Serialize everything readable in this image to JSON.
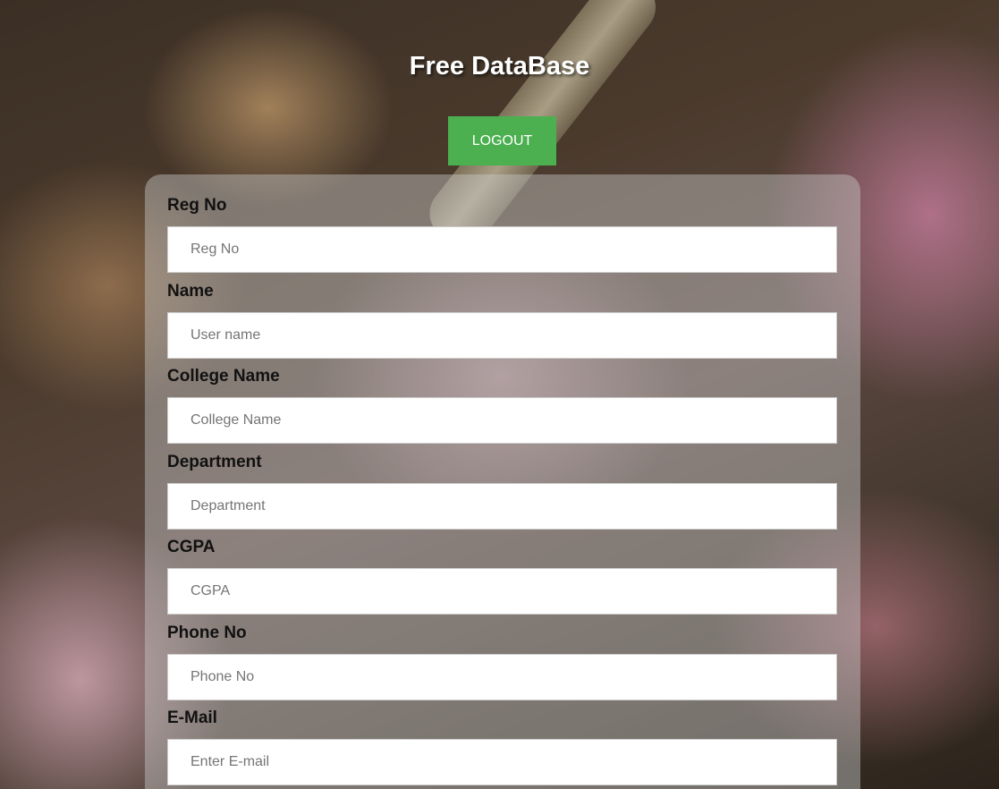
{
  "header": {
    "title": "Free DataBase",
    "logout_label": "LOGOUT"
  },
  "form": {
    "fields": [
      {
        "label": "Reg No",
        "placeholder": "Reg No",
        "value": ""
      },
      {
        "label": "Name",
        "placeholder": "User name",
        "value": ""
      },
      {
        "label": "College Name",
        "placeholder": "College Name",
        "value": ""
      },
      {
        "label": "Department",
        "placeholder": "Department",
        "value": ""
      },
      {
        "label": "CGPA",
        "placeholder": "CGPA",
        "value": ""
      },
      {
        "label": "Phone No",
        "placeholder": "Phone No",
        "value": ""
      },
      {
        "label": "E-Mail",
        "placeholder": "Enter E-mail",
        "value": ""
      }
    ]
  },
  "colors": {
    "logout_button": "#4caf50",
    "title_text": "#ffffff",
    "label_text": "#111111"
  }
}
